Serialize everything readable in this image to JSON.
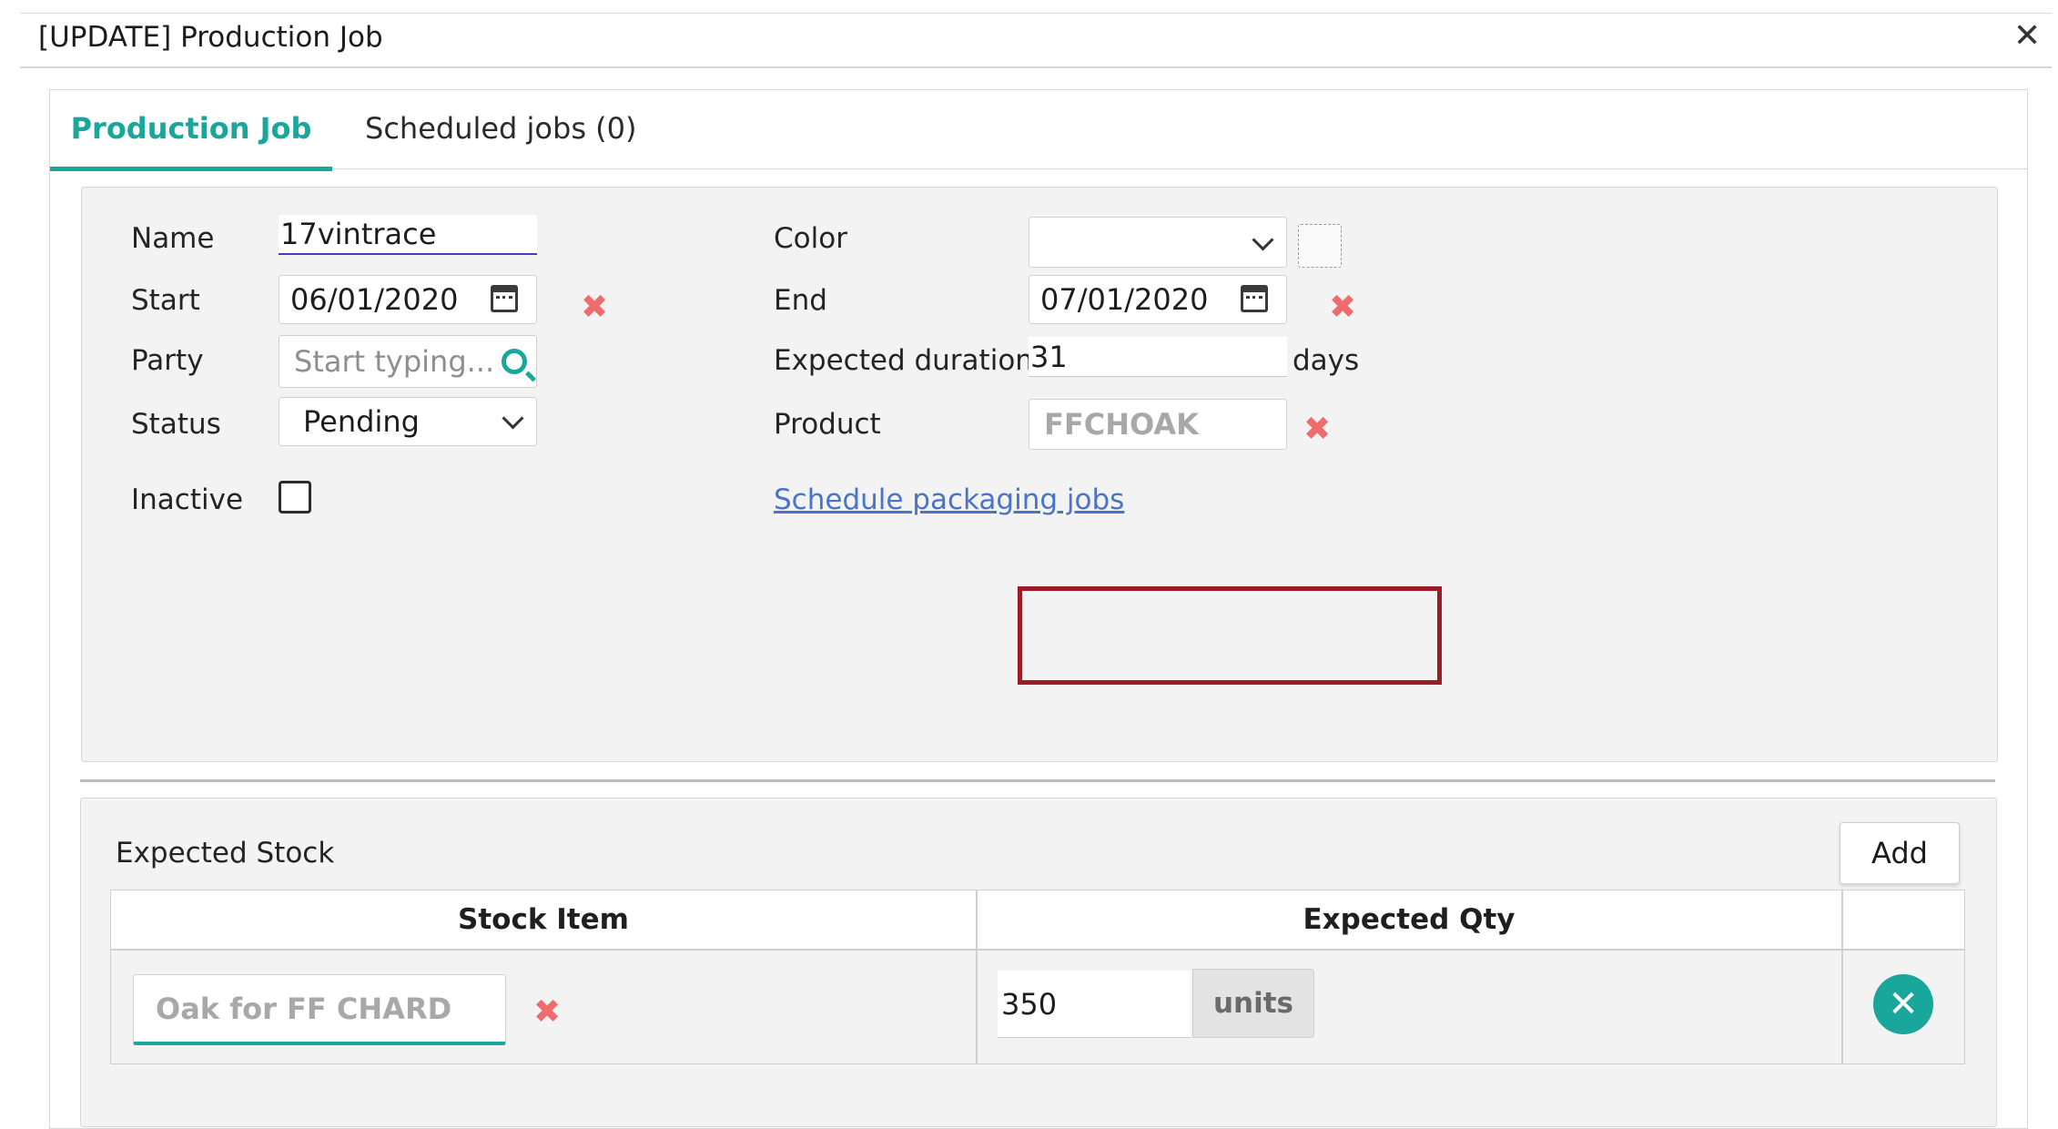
{
  "dialog": {
    "title": "[UPDATE] Production Job"
  },
  "tabs": [
    {
      "label": "Production Job"
    },
    {
      "label": "Scheduled jobs (0)"
    }
  ],
  "form": {
    "name": {
      "label": "Name",
      "value": "17vintrace"
    },
    "start": {
      "label": "Start",
      "value": "06/01/2020"
    },
    "party": {
      "label": "Party",
      "placeholder": "Start typing..."
    },
    "status": {
      "label": "Status",
      "value": "Pending"
    },
    "inactive": {
      "label": "Inactive",
      "checked": false
    },
    "color": {
      "label": "Color",
      "value": ""
    },
    "end": {
      "label": "End",
      "value": "07/01/2020"
    },
    "expected_duration": {
      "label": "Expected duration",
      "value": "31",
      "unit": "days"
    },
    "product": {
      "label": "Product",
      "value": "FFCHOAK"
    },
    "schedule_link": "Schedule packaging jobs"
  },
  "expected_stock": {
    "title": "Expected Stock",
    "add_label": "Add",
    "columns": [
      "Stock Item",
      "Expected Qty"
    ],
    "rows": [
      {
        "stock_item": "Oak for FF CHARD",
        "qty": "350",
        "unit": "units"
      }
    ]
  },
  "colors": {
    "accent": "#1aa79b",
    "delete": "#f06b6b",
    "link": "#4a73c9",
    "highlight": "#9b1c24"
  }
}
